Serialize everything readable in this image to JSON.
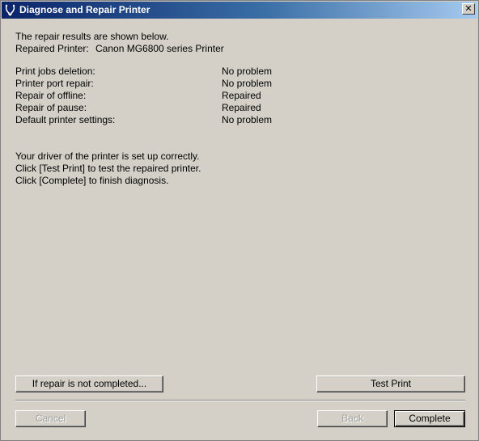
{
  "window": {
    "title": "Diagnose and Repair Printer",
    "icon": "printer-repair-icon",
    "close_label": "✕"
  },
  "summary": {
    "intro": "The repair results are shown below.",
    "printer_label": "Repaired Printer:",
    "printer_name": "Canon MG6800 series Printer"
  },
  "results": [
    {
      "label": "Print jobs deletion:",
      "value": "No problem"
    },
    {
      "label": "Printer port repair:",
      "value": "No problem"
    },
    {
      "label": "Repair of offline:",
      "value": "Repaired"
    },
    {
      "label": "Repair of pause:",
      "value": "Repaired"
    },
    {
      "label": "Default printer settings:",
      "value": "No problem"
    }
  ],
  "messages": {
    "line1": "Your driver of the printer is set up correctly.",
    "line2": "Click [Test Print] to test the repaired printer.",
    "line3": "Click [Complete] to finish diagnosis."
  },
  "buttons": {
    "not_completed": "If repair is not completed...",
    "test_print": "Test Print",
    "cancel": "Cancel",
    "back": "Back",
    "complete": "Complete"
  }
}
